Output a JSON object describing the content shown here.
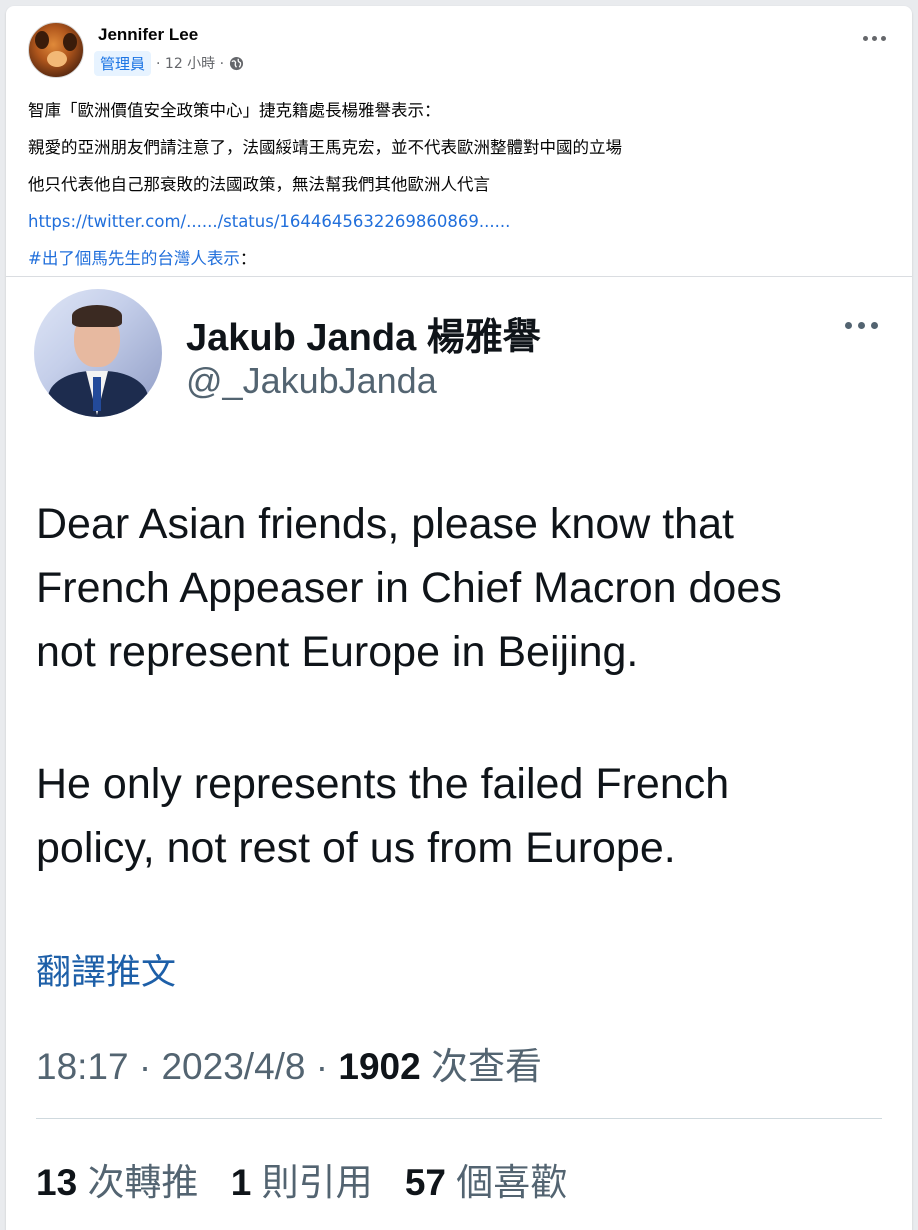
{
  "post": {
    "author": "Jennifer Lee",
    "role_badge": "管理員",
    "time": "· 12 小時 ·",
    "privacy_icon": "globe-icon",
    "more_icon": "more-horizontal-icon",
    "lines": [
      "智庫「歐洲價值安全政策中心」捷克籍處長楊雅譽表示：",
      "親愛的亞洲朋友們請注意了，法國綏靖王馬克宏，並不代表歐洲整體對中國的立場",
      "他只代表他自己那衰敗的法國政策，無法幫我們其他歐洲人代言"
    ],
    "link": "https://twitter.com/....../status/1644645632269860869......",
    "hashtag": "#出了個馬先生的台灣人表示",
    "hashtag_suffix": "："
  },
  "tweet": {
    "name": "Jakub Janda 楊雅譽",
    "handle": "@_JakubJanda",
    "paragraphs": [
      "Dear Asian friends, please know that\nFrench Appeaser in Chief Macron does\nnot represent Europe in Beijing.",
      "He only represents the failed French\npolicy, not rest of us from Europe."
    ],
    "translate": "翻譯推文",
    "time": "18:17",
    "date": "2023/4/8",
    "separator": "·",
    "views_count": "1902",
    "views_label": "次查看",
    "stats": [
      {
        "count": "13",
        "label": "次轉推"
      },
      {
        "count": "1",
        "label": "則引用"
      },
      {
        "count": "57",
        "label": "個喜歡"
      }
    ]
  }
}
